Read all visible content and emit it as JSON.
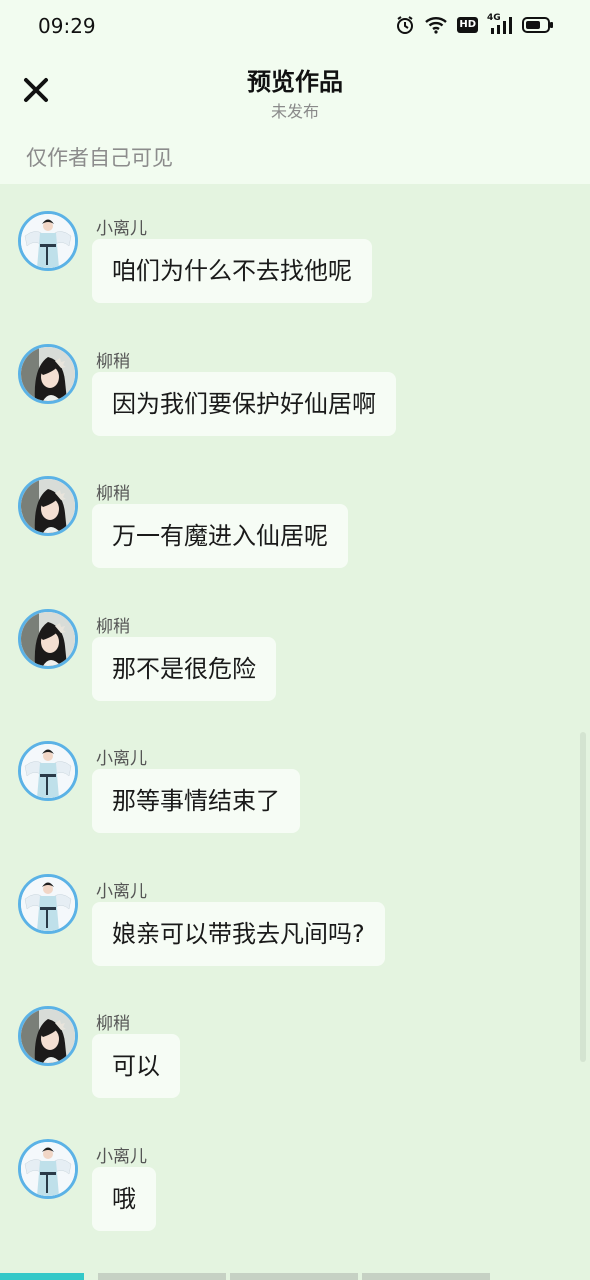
{
  "status_bar": {
    "time": "09:29",
    "icons": [
      "alarm-icon",
      "wifi-icon",
      "hd-icon",
      "signal-4g-icon",
      "battery-icon"
    ],
    "hd_label": "HD",
    "network_label": "4G"
  },
  "header": {
    "close_icon": "close-icon",
    "title": "预览作品",
    "subtitle": "未发布",
    "visibility_note": "仅作者自己可见"
  },
  "messages": [
    {
      "sender": "小离儿",
      "text": "咱们为什么不去找他呢",
      "avatar": "boy"
    },
    {
      "sender": "柳稍",
      "text": "因为我们要保护好仙居啊",
      "avatar": "woman"
    },
    {
      "sender": "柳稍",
      "text": "万一有魔进入仙居呢",
      "avatar": "woman"
    },
    {
      "sender": "柳稍",
      "text": "那不是很危险",
      "avatar": "woman"
    },
    {
      "sender": "小离儿",
      "text": "那等事情结束了",
      "avatar": "boy"
    },
    {
      "sender": "小离儿",
      "text": "娘亲可以带我去凡间吗?",
      "avatar": "boy"
    },
    {
      "sender": "柳稍",
      "text": "可以",
      "avatar": "woman"
    },
    {
      "sender": "小离儿",
      "text": "哦",
      "avatar": "boy"
    }
  ],
  "colors": {
    "background": "#e4f4e0",
    "header_bg": "#f2fcf0",
    "bubble_bg": "#f6fcf5",
    "avatar_ring": "#5bb2e6",
    "active_tab": "#33c8c8"
  }
}
